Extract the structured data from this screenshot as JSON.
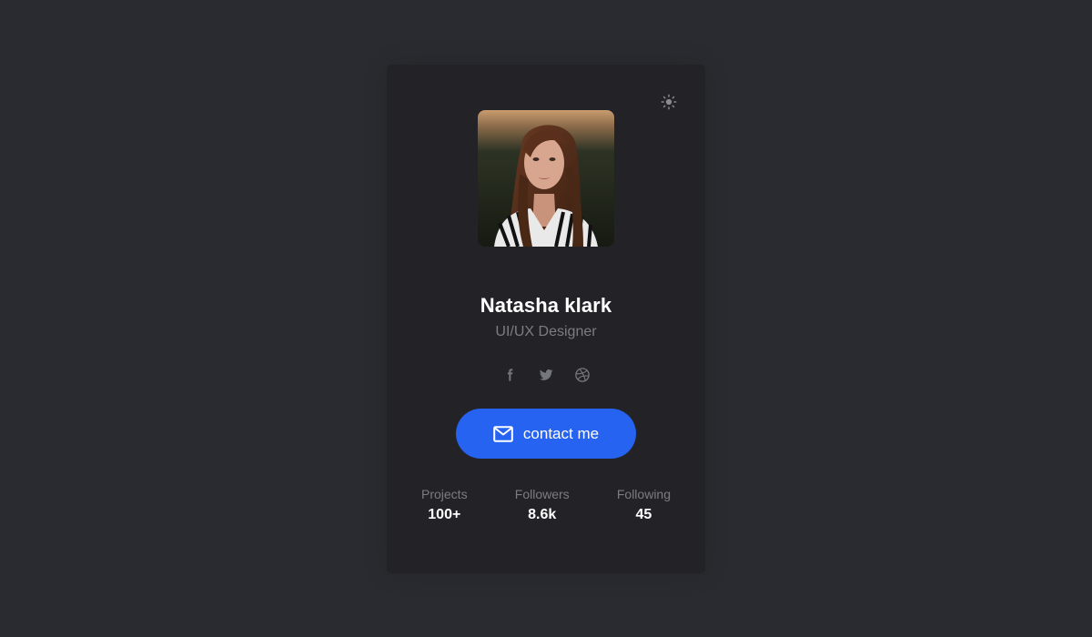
{
  "profile": {
    "name": "Natasha klark",
    "role": "UI/UX Designer",
    "photo_alt": "Profile photo"
  },
  "icons": {
    "theme": "sun-icon",
    "facebook": "facebook-icon",
    "twitter": "twitter-icon",
    "dribbble": "dribbble-icon",
    "mail": "mail-icon"
  },
  "contact": {
    "label": "contact me"
  },
  "stats": [
    {
      "label": "Projects",
      "value": "100+"
    },
    {
      "label": "Followers",
      "value": "8.6k"
    },
    {
      "label": "Following",
      "value": "45"
    }
  ],
  "colors": {
    "page_bg": "#2a2b30",
    "card_bg": "#222227",
    "accent": "#2563f0",
    "muted_text": "#7c7d83",
    "text": "#ffffff"
  }
}
